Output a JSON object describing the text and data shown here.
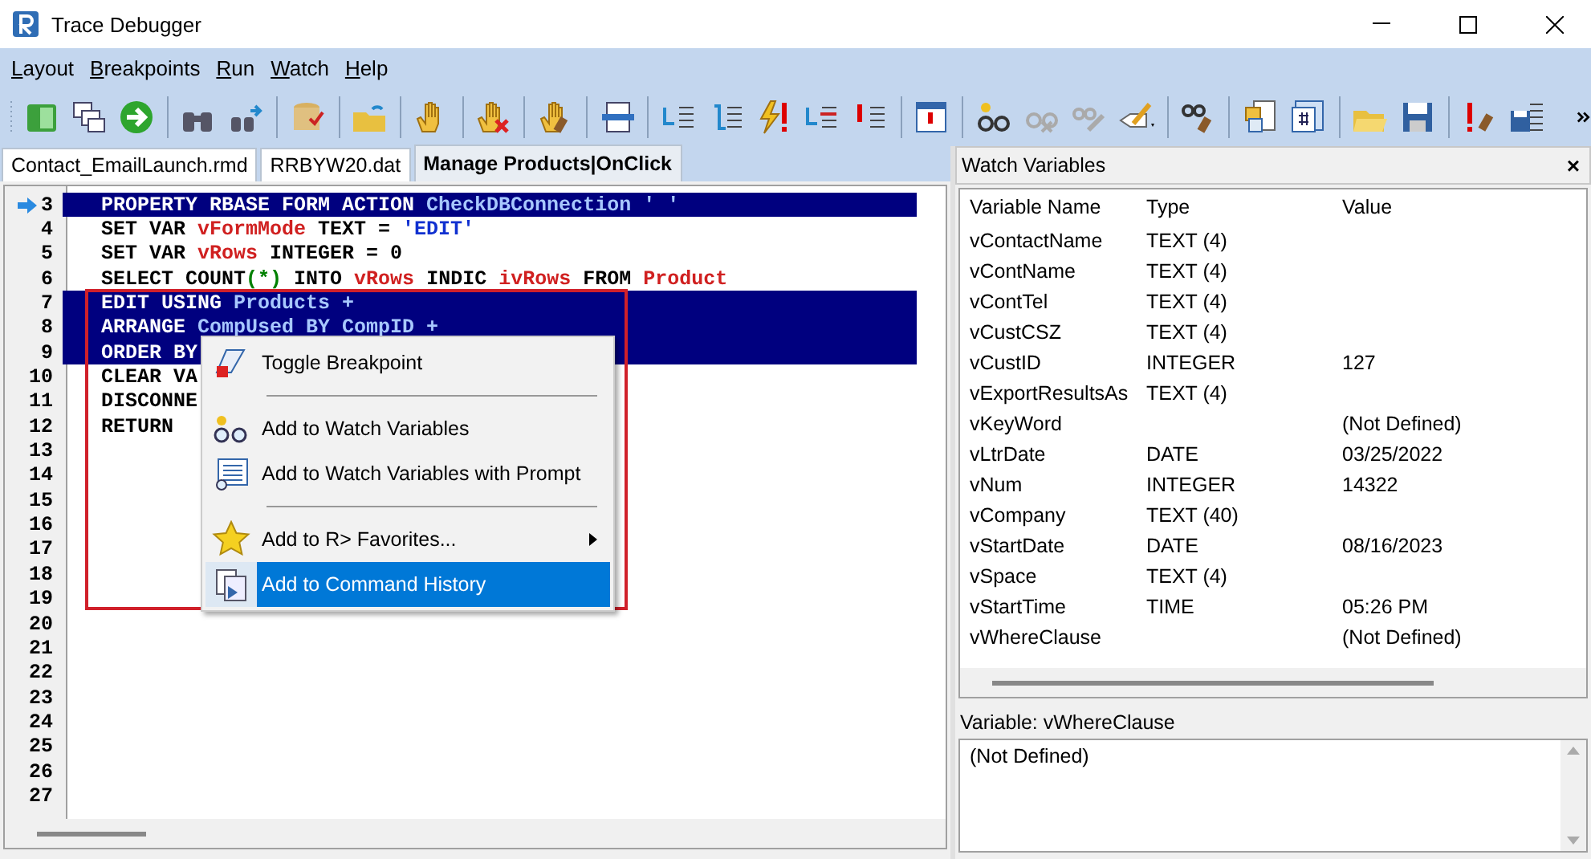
{
  "window": {
    "title": "Trace Debugger"
  },
  "menu": [
    {
      "label": "Layout"
    },
    {
      "label": "Breakpoints"
    },
    {
      "label": "Run"
    },
    {
      "label": "Watch"
    },
    {
      "label": "Help"
    }
  ],
  "tabs": [
    {
      "label": "Contact_EmailLaunch.rmd",
      "selected": false
    },
    {
      "label": "RRBYW20.dat",
      "selected": false
    },
    {
      "label": "Manage Products|OnClick",
      "selected": true
    }
  ],
  "editor": {
    "lines": [
      {
        "number": "3",
        "current": true,
        "selected": true,
        "tokens": [
          {
            "text": "PROPERTY RBASE FORM ACTION ",
            "kind": "plain"
          },
          {
            "text": "CheckDBConnection ' '",
            "kind": "ident"
          }
        ]
      },
      {
        "number": "4",
        "current": false,
        "selected": false,
        "tokens": [
          {
            "text": "SET VAR ",
            "kind": "plain"
          },
          {
            "text": "vFormMode",
            "kind": "variable"
          },
          {
            "text": " TEXT = ",
            "kind": "plain"
          },
          {
            "text": "'EDIT'",
            "kind": "string"
          }
        ]
      },
      {
        "number": "5",
        "current": false,
        "selected": false,
        "tokens": [
          {
            "text": "SET VAR ",
            "kind": "plain"
          },
          {
            "text": "vRows",
            "kind": "variable"
          },
          {
            "text": " INTEGER = 0",
            "kind": "plain"
          }
        ]
      },
      {
        "number": "6",
        "current": false,
        "selected": false,
        "tokens": [
          {
            "text": "SELECT COUNT",
            "kind": "plain"
          },
          {
            "text": "(*)",
            "kind": "operator"
          },
          {
            "text": " INTO ",
            "kind": "plain"
          },
          {
            "text": "vRows",
            "kind": "variable"
          },
          {
            "text": " INDIC ",
            "kind": "plain"
          },
          {
            "text": "ivRows",
            "kind": "variable"
          },
          {
            "text": " FROM ",
            "kind": "plain"
          },
          {
            "text": "Product",
            "kind": "variable"
          }
        ]
      },
      {
        "number": "7",
        "current": false,
        "selected": true,
        "tokens": [
          {
            "text": "EDIT USING ",
            "kind": "plain"
          },
          {
            "text": "Products +",
            "kind": "ident"
          }
        ]
      },
      {
        "number": "8",
        "current": false,
        "selected": true,
        "tokens": [
          {
            "text": "ARRANGE",
            "kind": "plain"
          },
          {
            "text": " CompUsed BY CompID +",
            "kind": "ident"
          }
        ]
      },
      {
        "number": "9",
        "current": false,
        "selected": true,
        "tokens": [
          {
            "text": "ORDER BY",
            "kind": "plain"
          }
        ]
      },
      {
        "number": "10",
        "current": false,
        "selected": false,
        "tokens": [
          {
            "text": "CLEAR VA",
            "kind": "plain"
          }
        ]
      },
      {
        "number": "11",
        "current": false,
        "selected": false,
        "tokens": [
          {
            "text": "DISCONNE",
            "kind": "plain"
          }
        ]
      },
      {
        "number": "12",
        "current": false,
        "selected": false,
        "tokens": [
          {
            "text": "RETURN",
            "kind": "plain"
          }
        ]
      },
      {
        "number": "13",
        "current": false,
        "selected": false
      },
      {
        "number": "14",
        "current": false,
        "selected": false
      },
      {
        "number": "15",
        "current": false,
        "selected": false
      },
      {
        "number": "16",
        "current": false,
        "selected": false
      },
      {
        "number": "17",
        "current": false,
        "selected": false
      },
      {
        "number": "18",
        "current": false,
        "selected": false
      },
      {
        "number": "19",
        "current": false,
        "selected": false
      },
      {
        "number": "20",
        "current": false,
        "selected": false
      },
      {
        "number": "21",
        "current": false,
        "selected": false
      },
      {
        "number": "22",
        "current": false,
        "selected": false
      },
      {
        "number": "23",
        "current": false,
        "selected": false
      },
      {
        "number": "24",
        "current": false,
        "selected": false
      },
      {
        "number": "25",
        "current": false,
        "selected": false
      },
      {
        "number": "26",
        "current": false,
        "selected": false
      },
      {
        "number": "27",
        "current": false,
        "selected": false
      }
    ]
  },
  "context_menu": {
    "items": [
      {
        "kind": "item",
        "label": "Toggle Breakpoint",
        "submenu": false,
        "selected": false
      },
      {
        "kind": "separator"
      },
      {
        "kind": "item",
        "label": "Add to Watch Variables",
        "submenu": false,
        "selected": false
      },
      {
        "kind": "item",
        "label": "Add to Watch Variables with Prompt",
        "submenu": false,
        "selected": false
      },
      {
        "kind": "separator"
      },
      {
        "kind": "item",
        "label": "Add to R> Favorites...",
        "submenu": true,
        "selected": false
      },
      {
        "kind": "item",
        "label": "Add to Command History",
        "submenu": false,
        "selected": true
      }
    ]
  },
  "watch": {
    "title": "Watch Variables",
    "close": "×",
    "columns": [
      "Variable Name",
      "Type",
      "Value"
    ],
    "rows": [
      {
        "name": "vContactName",
        "type": "TEXT (4)"
      },
      {
        "name": "vContName",
        "type": "TEXT (4)"
      },
      {
        "name": "vContTel",
        "type": "TEXT (4)"
      },
      {
        "name": "vCustCSZ",
        "type": "TEXT (4)"
      },
      {
        "name": "vCustID",
        "type": "INTEGER",
        "value": "127"
      },
      {
        "name": "vExportResultsAs",
        "type": "TEXT (4)"
      },
      {
        "name": "vKeyWord",
        "value": "(Not Defined)"
      },
      {
        "name": "vLtrDate",
        "type": "DATE",
        "value": "03/25/2022"
      },
      {
        "name": "vNum",
        "type": "INTEGER",
        "value": "14322"
      },
      {
        "name": "vCompany",
        "type": "TEXT (40)"
      },
      {
        "name": "vStartDate",
        "type": "DATE",
        "value": "08/16/2023"
      },
      {
        "name": "vSpace",
        "type": "TEXT (4)"
      },
      {
        "name": "vStartTime",
        "type": "TIME",
        "value": "05:26 PM"
      },
      {
        "name": "vWhereClause",
        "value": "(Not Defined)"
      }
    ],
    "detail_label": "Variable: vWhereClause",
    "detail_value": "(Not Defined)"
  }
}
